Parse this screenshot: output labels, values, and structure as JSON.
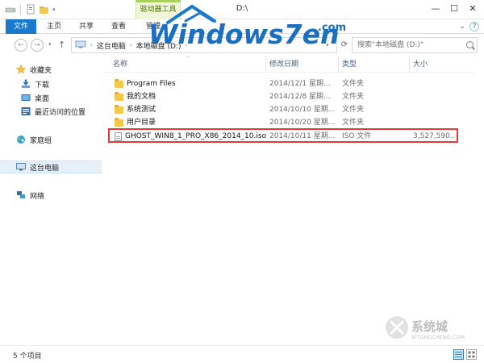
{
  "titlebar": {
    "title": "D:\\",
    "context_tab": "驱动器工具",
    "controls": {
      "minimize": "—",
      "maximize": "☐",
      "close": "✕"
    }
  },
  "ribbon": {
    "file_tab": "文件",
    "tabs": [
      "主页",
      "共享",
      "查看",
      "管理"
    ],
    "chevron": "⌄",
    "help": "?"
  },
  "address": {
    "path": [
      "这台电脑",
      "本地磁盘 (D:)"
    ],
    "search_placeholder": "搜索\"本地磁盘 (D:)\""
  },
  "nav": {
    "items": [
      {
        "label": "收藏夹"
      },
      {
        "label": "下载"
      },
      {
        "label": "桌面"
      },
      {
        "label": "最近访问的位置"
      },
      {
        "label": "家庭组"
      },
      {
        "label": "这台电脑"
      },
      {
        "label": "网络"
      }
    ]
  },
  "columns": [
    "名称",
    "修改日期",
    "类型",
    "大小"
  ],
  "files": [
    {
      "name": "Program Files",
      "date": "2014/12/1 星期...",
      "type": "文件夹",
      "size": ""
    },
    {
      "name": "我的文档",
      "date": "2014/12/8 星期...",
      "type": "文件夹",
      "size": ""
    },
    {
      "name": "系统测试",
      "date": "2014/10/10 星期...",
      "type": "文件夹",
      "size": ""
    },
    {
      "name": "用户目录",
      "date": "2014/10/20 星期...",
      "type": "文件夹",
      "size": ""
    },
    {
      "name": "GHOST_WIN8_1_PRO_X86_2014_10.iso",
      "date": "2014/10/11 星期...",
      "type": "ISO 文件",
      "size": "3,527,590..."
    }
  ],
  "status": {
    "count": "5 个项目"
  },
  "watermark": {
    "brand": "Windows7en",
    "domain": ".com",
    "bottom_brand": "系统城",
    "bottom_domain": "XITONGCHENG.COM"
  },
  "colors": {
    "accent": "#1979ca",
    "highlight": "#e03c3c",
    "folder": "#f3c94d"
  }
}
